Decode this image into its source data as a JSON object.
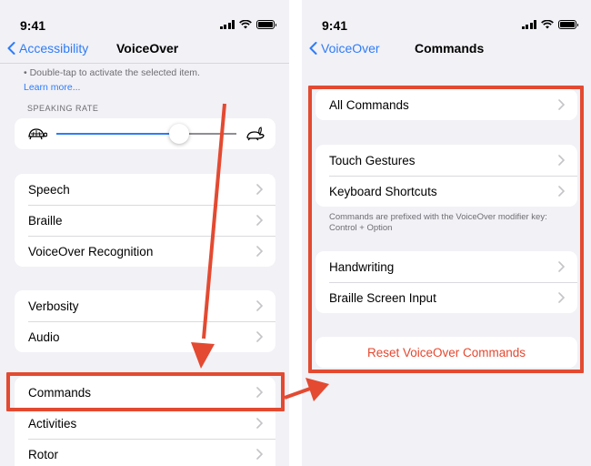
{
  "status": {
    "time": "9:41"
  },
  "left": {
    "back_label": "Accessibility",
    "title": "VoiceOver",
    "hint_text": "• Double-tap to activate the selected item.",
    "learn_more": "Learn more...",
    "speaking_rate_header": "SPEAKING RATE",
    "speaking_rate_value": 0.68,
    "groups": [
      {
        "items": [
          {
            "label": "Speech"
          },
          {
            "label": "Braille"
          },
          {
            "label": "VoiceOver Recognition"
          }
        ]
      },
      {
        "items": [
          {
            "label": "Verbosity"
          },
          {
            "label": "Audio"
          }
        ]
      },
      {
        "items": [
          {
            "label": "Commands"
          },
          {
            "label": "Activities"
          },
          {
            "label": "Rotor"
          }
        ]
      }
    ]
  },
  "right": {
    "back_label": "VoiceOver",
    "title": "Commands",
    "groups": [
      {
        "items": [
          {
            "label": "All Commands"
          }
        ]
      },
      {
        "items": [
          {
            "label": "Touch Gestures"
          },
          {
            "label": "Keyboard Shortcuts"
          }
        ]
      },
      {
        "items": [
          {
            "label": "Handwriting"
          },
          {
            "label": "Braille Screen Input"
          }
        ]
      }
    ],
    "footer_note": "Commands are prefixed with the VoiceOver modifier key: Control + Option",
    "reset_label": "Reset VoiceOver Commands"
  },
  "colors": {
    "accent": "#2f7cf6",
    "annotation": "#e34a31",
    "destructive": "#e5472f",
    "background": "#f1f1f6"
  }
}
